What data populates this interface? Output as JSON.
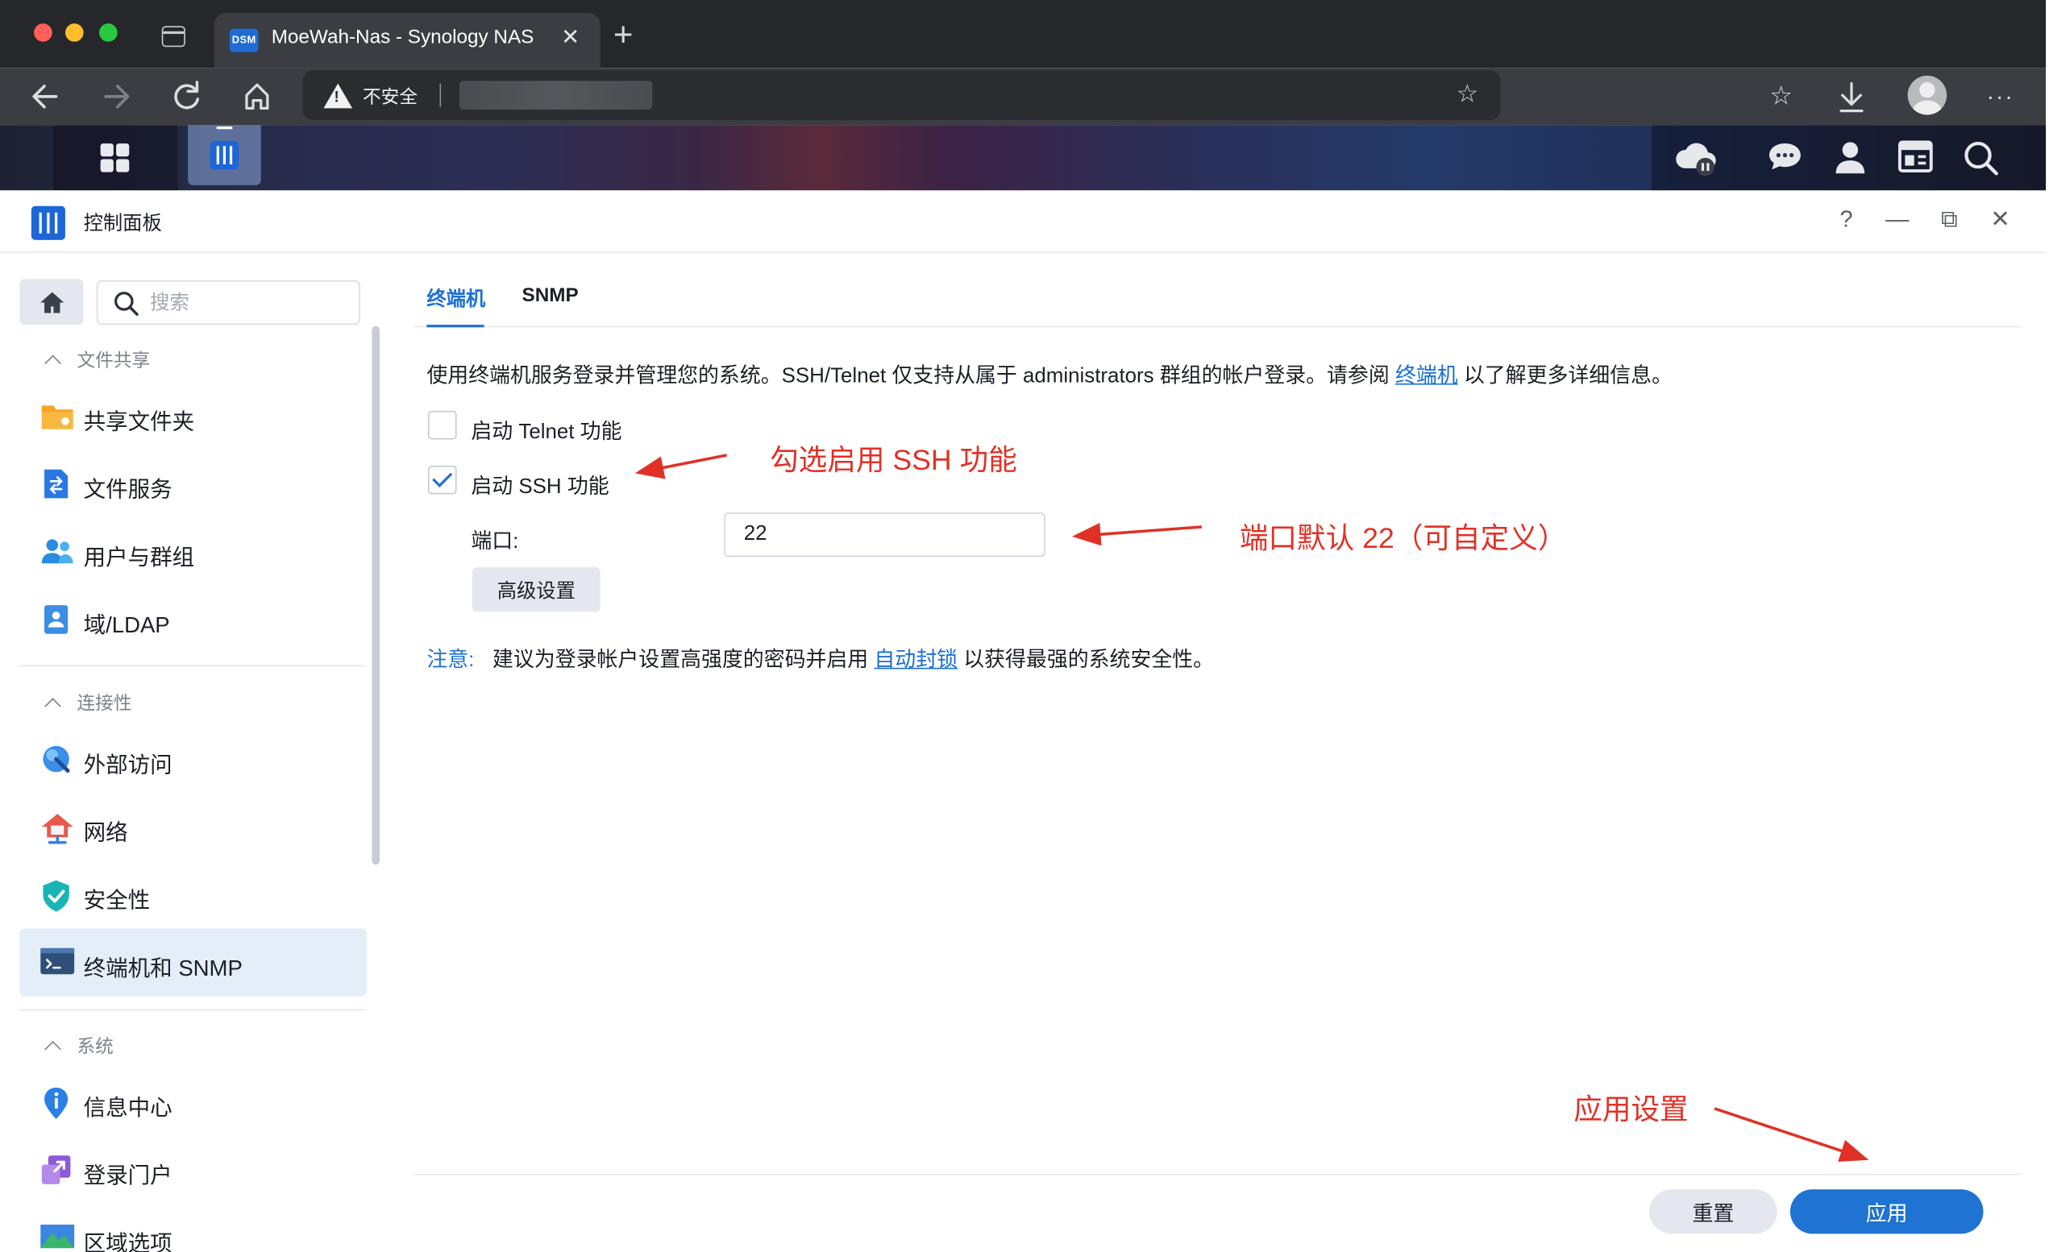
{
  "browser": {
    "tab_title": "MoeWah-Nas - Synology NAS",
    "tab_favicon_text": "DSM",
    "tab_close_icon": "close-icon",
    "new_tab_icon": "plus-icon",
    "address_warning": "不安全",
    "nav_icons": [
      "back-arrow-icon",
      "forward-arrow-icon",
      "reload-icon",
      "home-icon"
    ],
    "toolbar_icons": [
      "add-favorite-icon",
      "password-shield-icon",
      "extension-pinwheel-icon",
      "reading-card-icon",
      "favorites-icon",
      "download-icon",
      "profile-avatar-icon",
      "more-icon"
    ]
  },
  "dsm_taskbar": {
    "left_icons": [
      "main-menu-grid-icon",
      "control-panel-icon"
    ],
    "right_icons": [
      "cloud-sync-paused-icon",
      "chat-icon",
      "user-icon",
      "widgets-icon",
      "search-icon"
    ]
  },
  "window": {
    "title": "控制面板",
    "controls": {
      "help": "?",
      "minimize": "—",
      "restore": "⧉",
      "close": "✕"
    }
  },
  "sidebar": {
    "search_placeholder": "搜索",
    "sections": [
      {
        "title": "文件共享",
        "items": [
          {
            "label": "共享文件夹",
            "icon": "shared-folder-icon"
          },
          {
            "label": "文件服务",
            "icon": "file-services-icon"
          },
          {
            "label": "用户与群组",
            "icon": "users-groups-icon"
          },
          {
            "label": "域/LDAP",
            "icon": "domain-ldap-icon"
          }
        ]
      },
      {
        "title": "连接性",
        "items": [
          {
            "label": "外部访问",
            "icon": "external-access-icon"
          },
          {
            "label": "网络",
            "icon": "network-icon"
          },
          {
            "label": "安全性",
            "icon": "security-shield-icon"
          },
          {
            "label": "终端机和 SNMP",
            "icon": "terminal-icon",
            "selected": true
          }
        ]
      },
      {
        "title": "系统",
        "items": [
          {
            "label": "信息中心",
            "icon": "info-center-icon"
          },
          {
            "label": "登录门户",
            "icon": "login-portal-icon"
          },
          {
            "label": "区域选项",
            "icon": "regional-options-icon"
          }
        ]
      }
    ]
  },
  "main": {
    "tabs": [
      {
        "label": "终端机",
        "active": true
      },
      {
        "label": "SNMP",
        "active": false
      }
    ],
    "description": {
      "before": "使用终端机服务登录并管理您的系统。SSH/Telnet 仅支持从属于 administrators 群组的帐户登录。请参阅 ",
      "link": "终端机",
      "after": " 以了解更多详细信息。"
    },
    "telnet": {
      "label": "启动 Telnet 功能",
      "checked": false
    },
    "ssh": {
      "label": "启动 SSH 功能",
      "checked": true
    },
    "port": {
      "label": "端口:",
      "value": "22"
    },
    "advanced_button": "高级设置",
    "note": {
      "label": "注意:",
      "before": "建议为登录帐户设置高强度的密码并启用 ",
      "link": "自动封锁",
      "after": " 以获得最强的系统安全性。"
    },
    "buttons": {
      "reset": "重置",
      "apply": "应用"
    }
  },
  "annotations": {
    "ssh": "勾选启用 SSH 功能",
    "port": "端口默认 22（可自定义）",
    "apply": "应用设置",
    "color": "#e03127"
  },
  "colors": {
    "accent": "#1f73d2",
    "selected_bg": "#e3eef9",
    "button_gray": "#e4e8ee",
    "browser_dark": "#25272b",
    "annotation_red": "#e03127"
  }
}
